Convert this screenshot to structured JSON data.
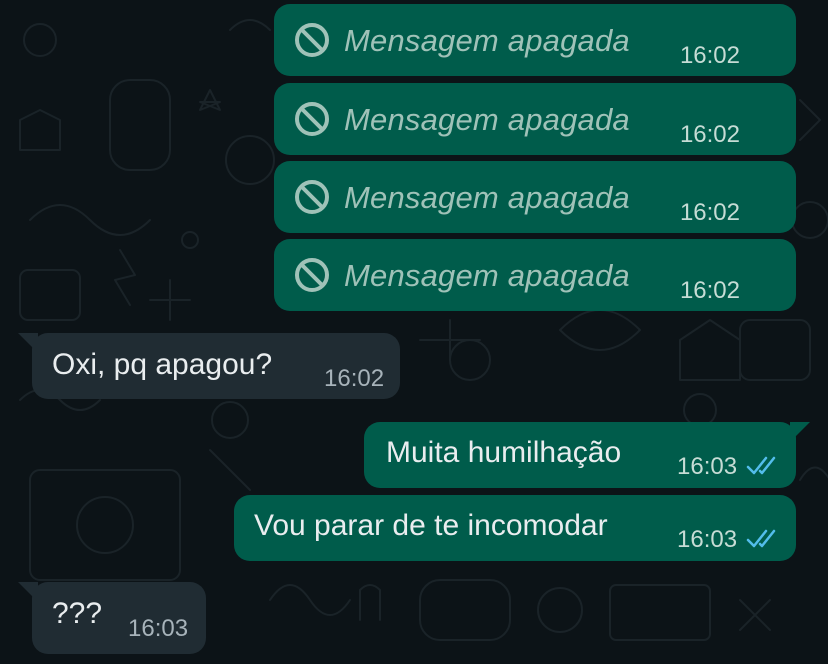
{
  "colors": {
    "background": "#0c1317",
    "outgoing_bubble": "#005c4b",
    "incoming_bubble": "#202c33",
    "deleted_text": "#9fc2b8",
    "read_ticks": "#53bdeb"
  },
  "messages": [
    {
      "direction": "outgoing",
      "deleted": true,
      "text": "Mensagem apagada",
      "time": "16:02",
      "icon": "deleted-block-icon"
    },
    {
      "direction": "outgoing",
      "deleted": true,
      "text": "Mensagem apagada",
      "time": "16:02",
      "icon": "deleted-block-icon"
    },
    {
      "direction": "outgoing",
      "deleted": true,
      "text": "Mensagem apagada",
      "time": "16:02",
      "icon": "deleted-block-icon"
    },
    {
      "direction": "outgoing",
      "deleted": true,
      "text": "Mensagem apagada",
      "time": "16:02",
      "icon": "deleted-block-icon"
    },
    {
      "direction": "incoming",
      "text": "Oxi, pq apagou?",
      "time": "16:02"
    },
    {
      "direction": "outgoing",
      "text": "Muita humilhação",
      "time": "16:03",
      "status": "read",
      "status_icon": "double-check-icon"
    },
    {
      "direction": "outgoing",
      "text": "Vou parar de te incomodar",
      "time": "16:03",
      "status": "read",
      "status_icon": "double-check-icon"
    },
    {
      "direction": "incoming",
      "text": "???",
      "time": "16:03"
    }
  ]
}
